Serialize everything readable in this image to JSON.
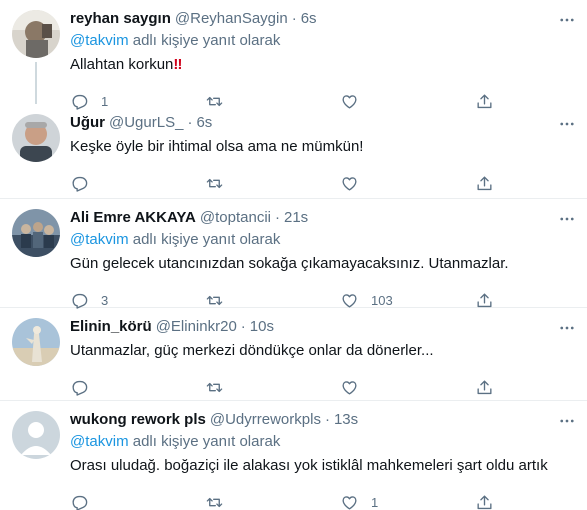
{
  "replying_to_prefix": "@takvim",
  "replying_to_suffix": " adlı kişiye yanıt olarak",
  "tweets": [
    {
      "name": "reyhan saygın",
      "handle": "@ReyhanSaygin",
      "time": "6s",
      "replying": true,
      "text": "Allahtan korkun",
      "emoji": "‼",
      "reply_count": "1",
      "retweet_count": "",
      "like_count": ""
    },
    {
      "name": "Uğur",
      "handle": "@UgurLS_",
      "time": "6s",
      "replying": false,
      "text": "Keşke öyle bir ihtimal olsa ama ne mümkün!",
      "reply_count": "",
      "retweet_count": "",
      "like_count": ""
    },
    {
      "name": "Ali Emre AKKAYA",
      "handle": "@toptancii",
      "time": "21s",
      "replying": true,
      "text": "Gün gelecek utancınızdan sokağa çıkamayacaksınız. Utanmazlar.",
      "reply_count": "3",
      "retweet_count": "",
      "like_count": "103"
    },
    {
      "name": "Elinin_körü",
      "handle": "@Elininkr20",
      "time": "10s",
      "replying": false,
      "text": "Utanmazlar, güç merkezi döndükçe onlar da dönerler...",
      "reply_count": "",
      "retweet_count": "",
      "like_count": ""
    },
    {
      "name": "wukong rework pls",
      "handle": "@Udyrreworkpls",
      "time": "13s",
      "replying": true,
      "text": "Orası uludağ. boğaziçi ile alakası yok istiklâl mahkemeleri şart oldu artık",
      "reply_count": "",
      "retweet_count": "",
      "like_count": "1"
    }
  ],
  "colors": {
    "text": "#0f1419",
    "secondary": "#5b7083",
    "link": "#1b95e0",
    "divider": "#ebeef0",
    "thread_line": "#cfd9de"
  },
  "icons": [
    "reply-icon",
    "retweet-icon",
    "like-icon",
    "share-icon",
    "more-icon"
  ]
}
